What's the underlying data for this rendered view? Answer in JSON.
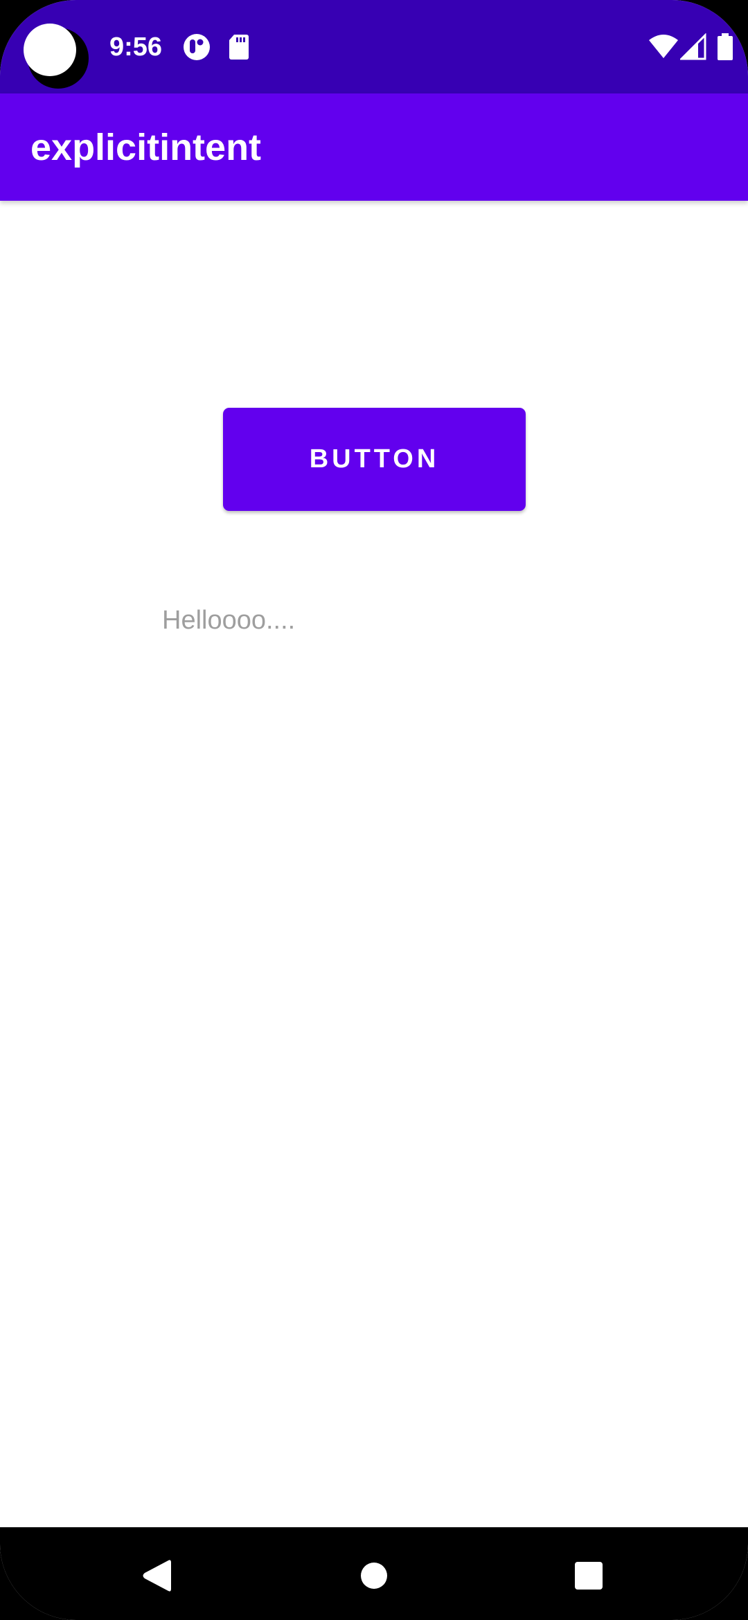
{
  "status_bar": {
    "time": "9:56",
    "icons": [
      "camera-cutout",
      "notification-app-icon",
      "sd-card-icon",
      "wifi-icon",
      "cellular-signal-icon",
      "battery-icon"
    ]
  },
  "app_bar": {
    "title": "explicitintent"
  },
  "main": {
    "button_label": "BUTTON",
    "hello_text": "Helloooo...."
  },
  "nav_bar": {
    "icons": [
      "back-icon",
      "home-icon",
      "recents-icon"
    ]
  },
  "colors": {
    "status_bar": "#3700B3",
    "app_bar": "#6200EE",
    "button": "#6200EE",
    "hello_text": "#9E9E9E",
    "nav_bar": "#000000"
  }
}
